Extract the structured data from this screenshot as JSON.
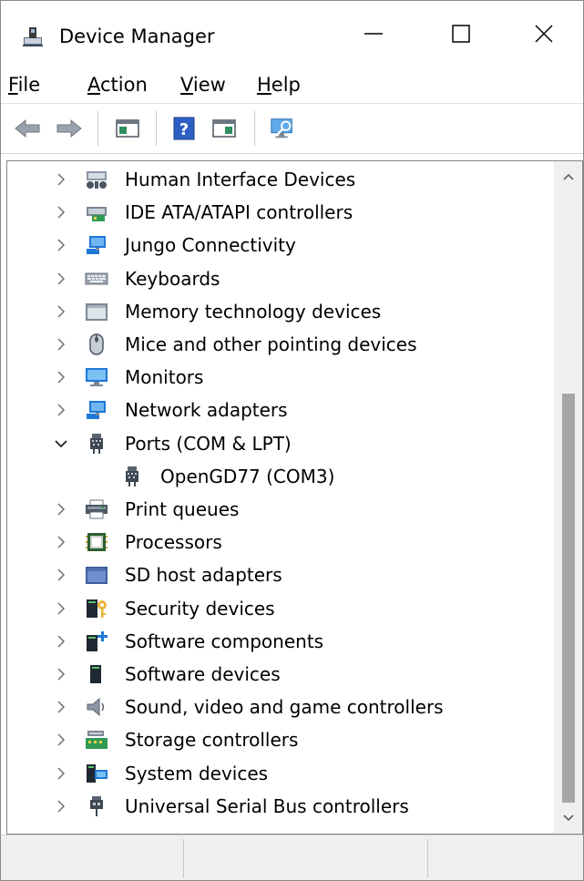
{
  "window": {
    "title": "Device Manager",
    "controls": {
      "minimize": "minimize-icon",
      "maximize": "maximize-icon",
      "close": "close-icon"
    }
  },
  "menu": [
    {
      "accel": "F",
      "rest": "ile"
    },
    {
      "accel": "A",
      "rest": "ction"
    },
    {
      "accel": "V",
      "rest": "iew"
    },
    {
      "accel": "H",
      "rest": "elp"
    }
  ],
  "toolbar": {
    "buttons": [
      "back-arrow-icon",
      "forward-arrow-icon",
      "show-hide-console-tree-icon",
      "help-icon",
      "action-pane-icon",
      "scan-hardware-icon"
    ]
  },
  "tree": {
    "items": [
      {
        "label": "Human Interface Devices",
        "icon": "hid-icon",
        "expanded": false
      },
      {
        "label": "IDE ATA/ATAPI controllers",
        "icon": "ide-controller-icon",
        "expanded": false
      },
      {
        "label": "Jungo Connectivity",
        "icon": "network-computer-icon",
        "expanded": false
      },
      {
        "label": "Keyboards",
        "icon": "keyboard-icon",
        "expanded": false
      },
      {
        "label": "Memory technology devices",
        "icon": "memory-device-icon",
        "expanded": false
      },
      {
        "label": "Mice and other pointing devices",
        "icon": "mouse-icon",
        "expanded": false
      },
      {
        "label": "Monitors",
        "icon": "monitor-icon",
        "expanded": false
      },
      {
        "label": "Network adapters",
        "icon": "network-adapter-icon",
        "expanded": false
      },
      {
        "label": "Ports (COM & LPT)",
        "icon": "port-icon",
        "expanded": true
      },
      {
        "label": "OpenGD77 (COM3)",
        "icon": "port-icon",
        "child": true
      },
      {
        "label": "Print queues",
        "icon": "printer-icon",
        "expanded": false
      },
      {
        "label": "Processors",
        "icon": "processor-icon",
        "expanded": false
      },
      {
        "label": "SD host adapters",
        "icon": "sd-adapter-icon",
        "expanded": false
      },
      {
        "label": "Security devices",
        "icon": "security-device-icon",
        "expanded": false
      },
      {
        "label": "Software components",
        "icon": "software-component-icon",
        "expanded": false
      },
      {
        "label": "Software devices",
        "icon": "software-device-icon",
        "expanded": false
      },
      {
        "label": "Sound, video and game controllers",
        "icon": "speaker-icon",
        "expanded": false
      },
      {
        "label": "Storage controllers",
        "icon": "storage-controller-icon",
        "expanded": false
      },
      {
        "label": "System devices",
        "icon": "system-device-icon",
        "expanded": false
      },
      {
        "label": "Universal Serial Bus controllers",
        "icon": "usb-icon",
        "expanded": false
      }
    ]
  },
  "scrollbar": {
    "position_fraction": 0.33,
    "visible_fraction": 0.67
  },
  "colors": {
    "accent_blue": "#1e78d6",
    "statusbar": "#f0f0f0",
    "scroll_thumb": "#a6a6a6"
  }
}
